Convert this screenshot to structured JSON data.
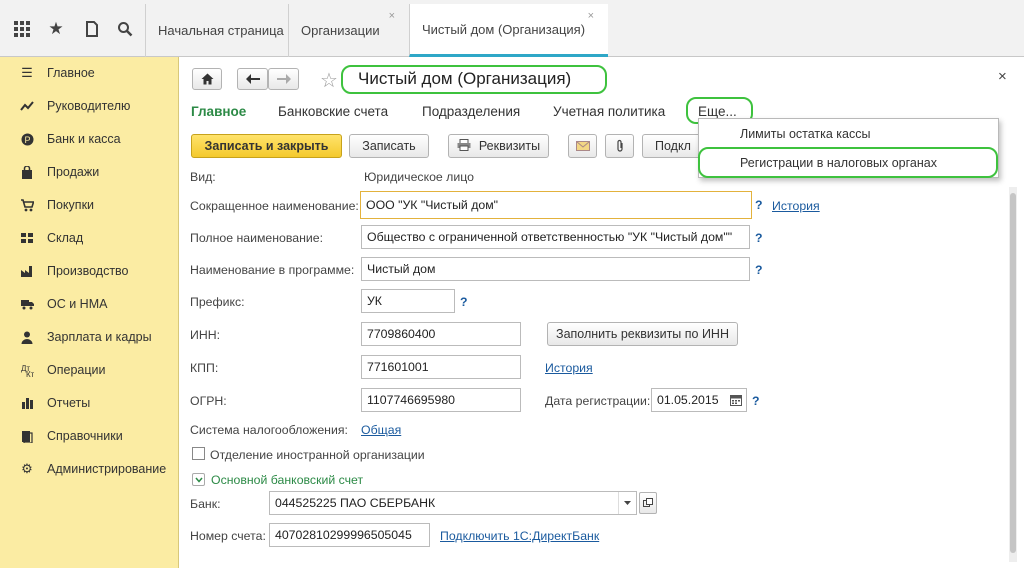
{
  "topbar": {
    "icons": [
      "grid-icon",
      "star-icon",
      "history-icon",
      "search-icon"
    ],
    "tabs": [
      {
        "label": "Начальная страница"
      },
      {
        "label": "Организации",
        "close": "×"
      },
      {
        "label": "Чистый дом (Организация)",
        "close": "×"
      }
    ]
  },
  "sidebar": {
    "items": [
      {
        "label": "Главное",
        "icon": "menu-icon"
      },
      {
        "label": "Руководителю",
        "icon": "trend-icon"
      },
      {
        "label": "Банк и касса",
        "icon": "coin-icon"
      },
      {
        "label": "Продажи",
        "icon": "bag-icon"
      },
      {
        "label": "Покупки",
        "icon": "cart-icon"
      },
      {
        "label": "Склад",
        "icon": "warehouse-icon"
      },
      {
        "label": "Производство",
        "icon": "factory-icon"
      },
      {
        "label": "ОС и НМА",
        "icon": "truck-icon"
      },
      {
        "label": "Зарплата и кадры",
        "icon": "person-icon"
      },
      {
        "label": "Операции",
        "icon": "operations-icon"
      },
      {
        "label": "Отчеты",
        "icon": "chart-icon"
      },
      {
        "label": "Справочники",
        "icon": "book-icon"
      },
      {
        "label": "Администрирование",
        "icon": "gear-icon"
      }
    ]
  },
  "form": {
    "title": "Чистый дом (Организация)",
    "close": "×",
    "nav": [
      "Главное",
      "Банковские счета",
      "Подразделения",
      "Учетная политика",
      "Еще..."
    ],
    "dropdown": [
      "Лимиты остатка кассы",
      "Регистрации в налоговых органах"
    ],
    "toolbar": {
      "save_close": "Записать и закрыть",
      "save": "Записать",
      "requisites": "Реквизиты",
      "connect": "Подкл"
    },
    "vid_label": "Вид:",
    "vid_value": "Юридическое лицо",
    "short_name_label": "Сокращенное наименование:",
    "short_name": "ООО \"УК \"Чистый дом\"",
    "history": "История",
    "full_name_label": "Полное наименование:",
    "full_name": "Общество с ограниченной ответственностью \"УК \"Чистый дом\"\"",
    "prog_name_label": "Наименование в программе:",
    "prog_name": "Чистый дом",
    "prefix_label": "Префикс:",
    "prefix": "УК",
    "inn_label": "ИНН:",
    "inn": "7709860400",
    "fill_by_inn": "Заполнить реквизиты по ИНН",
    "kpp_label": "КПП:",
    "kpp": "771601001",
    "ogrn_label": "ОГРН:",
    "ogrn": "1107746695980",
    "reg_date_label": "Дата регистрации:",
    "reg_date": "01.05.2015",
    "tax_system_label": "Система налогообложения:",
    "tax_system": "Общая",
    "foreign_branch": "Отделение иностранной организации",
    "bank_section": "Основной банковский счет",
    "bank_label": "Банк:",
    "bank": "044525225 ПАО СБЕРБАНК",
    "account_label": "Номер счета:",
    "account": "40702810299996505045",
    "directbank": "Подключить 1С:ДиректБанк",
    "help": "?"
  },
  "colors": {
    "sidebar_bg": "#fbeca3",
    "primary_button": "#f4c92d",
    "highlight_ring": "#3ec23e",
    "link": "#1a5a9e",
    "active_nav": "#2c8a46"
  }
}
